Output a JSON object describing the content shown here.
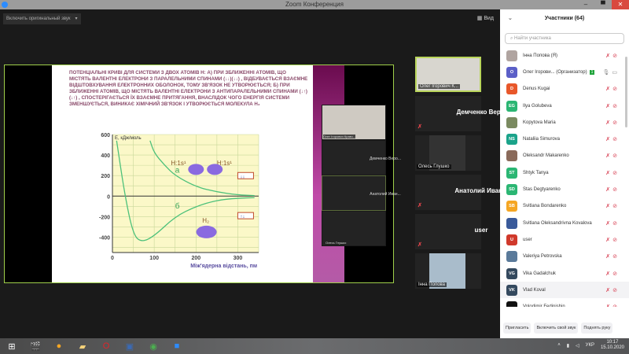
{
  "window": {
    "title": "Zoom Конференция",
    "min": "–",
    "max": "▀",
    "close": "✕"
  },
  "toolbar": {
    "original_sound": "Включить оригинальный звук",
    "dropdown": "▾",
    "view": "Вид",
    "view_icon": "grid-icon"
  },
  "slide": {
    "text": "Потенціальні криві для системи з двох атомів Н: а) при зближенні атомів, що містять валентні електрони з паралельними спинами (↓↓)(↓↓) , відбувається взаємне відштовхування електронних оболонок, тому зв'язок не утворюється; б) при зближенні атомів, що містять валентні електрони з антипаралельними спинами (↓↑)(↓↑) , спостерігається їх взаємне притягання, внаслідок чого енергія системи зменшується, виникає хімічний зв'язок і утворюється молекула Н₂",
    "atom_label_left": "H:1s¹",
    "atom_label_right": "H:1s¹",
    "molecule_label": "H₂",
    "spin_a": "↓↓",
    "spin_b": "↑↓"
  },
  "chart_data": {
    "type": "line",
    "title": "",
    "ylabel": "E, кДж/моль",
    "xlabel": "Між'ядерна відстань, пм",
    "xlim": [
      0,
      350
    ],
    "ylim": [
      -550,
      600
    ],
    "grid": true,
    "xticks": [
      0,
      100,
      200,
      300
    ],
    "yticks": [
      600,
      400,
      200,
      0,
      -200,
      -400
    ],
    "series": [
      {
        "name": "а",
        "x": [
          90,
          100,
          125,
          150,
          200,
          250,
          300,
          340
        ],
        "y": [
          540,
          420,
          300,
          200,
          90,
          40,
          12,
          5
        ]
      },
      {
        "name": "б",
        "x": [
          10,
          30,
          50,
          70,
          100,
          150,
          200,
          250,
          300,
          340
        ],
        "y": [
          540,
          0,
          -380,
          -450,
          -390,
          -200,
          -100,
          -40,
          -20,
          -15
        ]
      }
    ]
  },
  "thumbs": [
    "Олег Ігорович Кравч...",
    "Демченко Веро...",
    "Анатолий Иван...",
    "Олесь Глушко"
  ],
  "gallery": [
    {
      "name": "Олег Ігорович К...",
      "type": "video"
    },
    {
      "name": "Демченко Вер...",
      "type": "name"
    },
    {
      "name": "Олесь Глушко",
      "type": "photo"
    },
    {
      "name": "Анатолий Иван...",
      "type": "name"
    },
    {
      "name": "user",
      "type": "name"
    },
    {
      "name": "Інна Попова",
      "type": "photo"
    }
  ],
  "participants": {
    "title": "Участники (64)",
    "search_placeholder": "Найти участника",
    "items": [
      {
        "name": "Інна Попова (Я)",
        "initials": "",
        "color": "#b0a4a0"
      },
      {
        "name": "Олег Ігорови... (Организатор)",
        "initials": "O",
        "color": "#5b5fc7",
        "host": true
      },
      {
        "name": "Denus Kugai",
        "initials": "D",
        "color": "#e8572a"
      },
      {
        "name": "Ilya Golubeva",
        "initials": "EG",
        "color": "#2bb673"
      },
      {
        "name": "Kopytova Maria",
        "initials": "",
        "color": "#7a8a60"
      },
      {
        "name": "Nataliia Simurova",
        "initials": "NS",
        "color": "#1aa38a"
      },
      {
        "name": "Oleksandr Makarenko",
        "initials": "",
        "color": "#8a6a5a"
      },
      {
        "name": "Shtyk Tanya",
        "initials": "ST",
        "color": "#2bb673"
      },
      {
        "name": "Stas Degtyarenko",
        "initials": "SD",
        "color": "#2bb673"
      },
      {
        "name": "Svitlana Bondarenko",
        "initials": "SB",
        "color": "#f5a623"
      },
      {
        "name": "Svitlana Oleksandrivna Kovalova",
        "initials": "",
        "color": "#3a5a9a"
      },
      {
        "name": "user",
        "initials": "U",
        "color": "#d0392b"
      },
      {
        "name": "Valeriya Petrovska",
        "initials": "",
        "color": "#5a7a9a"
      },
      {
        "name": "Vika Gadalchuk",
        "initials": "VG",
        "color": "#34495e"
      },
      {
        "name": "Vlad Koval",
        "initials": "VK",
        "color": "#34495e"
      },
      {
        "name": "Volodimir Fedinishin",
        "initials": "",
        "color": "#111"
      }
    ],
    "host_badge": "1",
    "buttons": {
      "invite": "Пригласить",
      "unmute": "Включить свой звук",
      "raise_hand": "Поднять руку"
    }
  },
  "taskbar": {
    "lang": "УКР",
    "time": "10:17",
    "date": "15.10.2020"
  }
}
